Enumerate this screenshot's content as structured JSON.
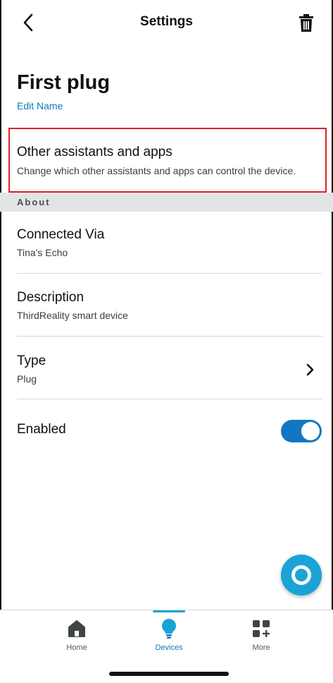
{
  "header": {
    "title": "Settings",
    "back_icon": "chevron-left-icon",
    "delete_icon": "trash-icon"
  },
  "device": {
    "name": "First plug",
    "edit_label": "Edit Name"
  },
  "assistants": {
    "title": "Other assistants and apps",
    "description": "Change which other assistants and apps can control the device."
  },
  "about": {
    "section_label": "About",
    "connected_via": {
      "title": "Connected Via",
      "value": "Tina's Echo"
    },
    "description": {
      "title": "Description",
      "value": "ThirdReality smart device"
    },
    "type": {
      "title": "Type",
      "value": "Plug"
    },
    "enabled": {
      "title": "Enabled",
      "state": "on"
    }
  },
  "bottom_nav": {
    "items": [
      {
        "label": "Home",
        "icon": "home-icon",
        "active": false
      },
      {
        "label": "Devices",
        "icon": "lightbulb-icon",
        "active": true
      },
      {
        "label": "More",
        "icon": "more-grid-icon",
        "active": false
      }
    ]
  },
  "colors": {
    "accent": "#1276c2",
    "link": "#0a7bb4",
    "highlight_border": "#e01e24",
    "alexa": "#1aa3d6"
  }
}
